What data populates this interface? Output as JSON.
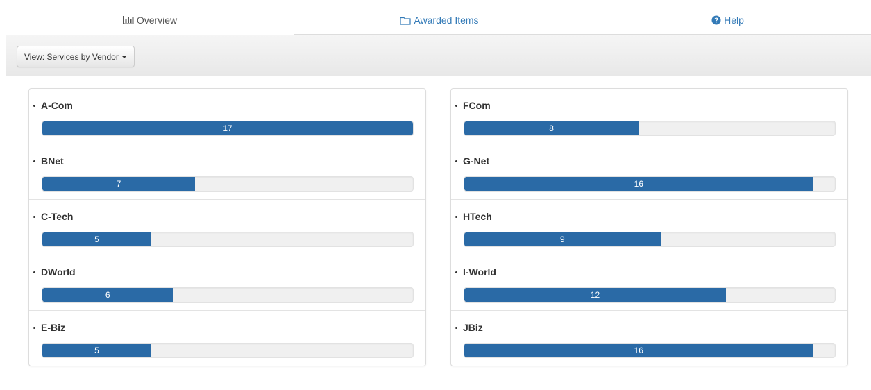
{
  "tabs": [
    {
      "label": "Overview",
      "icon": "bar-chart-icon",
      "active": true
    },
    {
      "label": "Awarded Items",
      "icon": "folder-icon",
      "active": false
    },
    {
      "label": "Help",
      "icon": "question-circle-icon",
      "active": false
    }
  ],
  "toolbar": {
    "view_label": "View: Services by Vendor"
  },
  "max_value": 17,
  "accent_color": "#2a6aa6",
  "vendors_left": [
    {
      "name": "A-Com",
      "value": 17
    },
    {
      "name": "BNet",
      "value": 7
    },
    {
      "name": "C-Tech",
      "value": 5
    },
    {
      "name": "DWorld",
      "value": 6
    },
    {
      "name": "E-Biz",
      "value": 5
    }
  ],
  "vendors_right": [
    {
      "name": "FCom",
      "value": 8
    },
    {
      "name": "G-Net",
      "value": 16
    },
    {
      "name": "HTech",
      "value": 9
    },
    {
      "name": "I-World",
      "value": 12
    },
    {
      "name": "JBiz",
      "value": 16
    }
  ]
}
